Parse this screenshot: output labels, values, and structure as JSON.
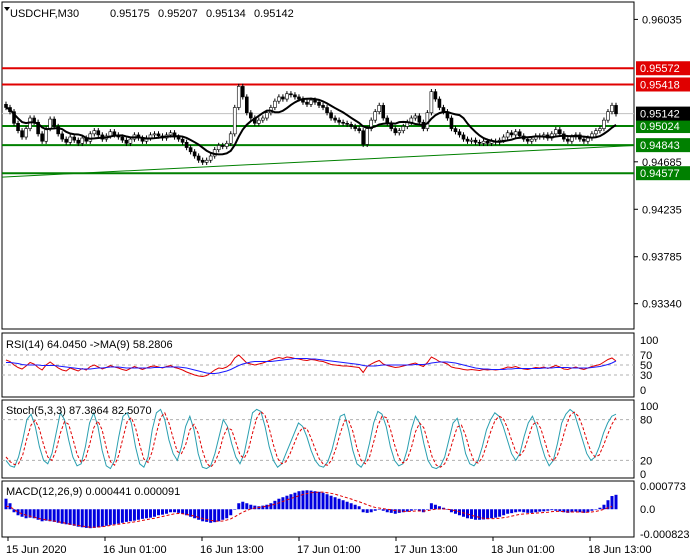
{
  "chart_data": [
    {
      "type": "candlestick",
      "title": "USDCHF,M30",
      "ohlc_header": [
        "0.95175",
        "0.95207",
        "0.95134",
        "0.95142"
      ],
      "ylim": [
        0.931,
        0.962
      ],
      "y_ticks": [
        "0.96035",
        "0.94685",
        "0.94235",
        "0.93785",
        "0.93340"
      ],
      "x_ticks": [
        "15 Jun 2020",
        "16 Jun 01:00",
        "16 Jun 13:00",
        "17 Jun 01:00",
        "17 Jun 13:00",
        "18 Jun 01:00",
        "18 Jun 13:00"
      ],
      "current_price": "0.95142",
      "levels": [
        {
          "label": "0.95572",
          "value": 0.95572,
          "color": "#e00000"
        },
        {
          "label": "0.95418",
          "value": 0.95418,
          "color": "#e00000"
        },
        {
          "label": "0.95024",
          "value": 0.95024,
          "color": "#008000"
        },
        {
          "label": "0.94843",
          "value": 0.94843,
          "color": "#008000"
        },
        {
          "label": "0.94577",
          "value": 0.94577,
          "color": "#008000"
        }
      ],
      "close": [
        0.952,
        0.9516,
        0.9505,
        0.9498,
        0.9492,
        0.95,
        0.951,
        0.9506,
        0.9495,
        0.9488,
        0.95,
        0.9509,
        0.9502,
        0.9495,
        0.949,
        0.9487,
        0.9492,
        0.9489,
        0.9486,
        0.9491,
        0.9488,
        0.9495,
        0.9498,
        0.9494,
        0.949,
        0.9493,
        0.9497,
        0.9494,
        0.9492,
        0.9489,
        0.9486,
        0.949,
        0.9494,
        0.9491,
        0.9488,
        0.9491,
        0.9494,
        0.9495,
        0.9493,
        0.9491,
        0.9494,
        0.9496,
        0.9492,
        0.949,
        0.9487,
        0.9482,
        0.9478,
        0.9474,
        0.947,
        0.9468,
        0.947,
        0.9474,
        0.948,
        0.9484,
        0.9483,
        0.9486,
        0.9495,
        0.952,
        0.954,
        0.953,
        0.9515,
        0.951,
        0.9505,
        0.9508,
        0.951,
        0.9515,
        0.952,
        0.9526,
        0.953,
        0.9528,
        0.9533,
        0.9532,
        0.953,
        0.9528,
        0.9525,
        0.9523,
        0.9527,
        0.9525,
        0.9522,
        0.952,
        0.9515,
        0.951,
        0.9508,
        0.9506,
        0.9505,
        0.9504,
        0.9502,
        0.95,
        0.9498,
        0.9485,
        0.95,
        0.9508,
        0.9516,
        0.9522,
        0.951,
        0.9505,
        0.95,
        0.9496,
        0.9498,
        0.9502,
        0.9506,
        0.951,
        0.9512,
        0.9506,
        0.95,
        0.9515,
        0.9535,
        0.9528,
        0.952,
        0.9516,
        0.951,
        0.95,
        0.9497,
        0.9494,
        0.949,
        0.9488,
        0.9489,
        0.9487,
        0.9486,
        0.9488,
        0.9486,
        0.9488,
        0.9487,
        0.9489,
        0.9492,
        0.9496,
        0.9494,
        0.9497,
        0.9493,
        0.949,
        0.9488,
        0.949,
        0.9493,
        0.9492,
        0.9494,
        0.9491,
        0.9495,
        0.9499,
        0.9495,
        0.949,
        0.9488,
        0.9492,
        0.9494,
        0.949,
        0.9488,
        0.9491,
        0.9495,
        0.9498,
        0.95,
        0.9508,
        0.9516,
        0.9522,
        0.9514
      ],
      "ma_note": "black moving average overlay",
      "trendline": {
        "from": 0.9454,
        "to": 0.9484,
        "color": "#008000"
      }
    },
    {
      "type": "line",
      "title": "RSI(14) 64.0450  ->MA(9) 58.2806",
      "ylim": [
        0,
        100
      ],
      "y_ticks": [
        "100",
        "70",
        "50",
        "30",
        "0"
      ],
      "values": [
        60,
        57,
        50,
        45,
        42,
        48,
        55,
        52,
        45,
        40,
        50,
        56,
        50,
        44,
        40,
        38,
        44,
        41,
        38,
        43,
        40,
        47,
        50,
        46,
        42,
        45,
        49,
        46,
        44,
        41,
        39,
        43,
        47,
        44,
        41,
        44,
        47,
        48,
        46,
        44,
        47,
        49,
        45,
        43,
        40,
        36,
        33,
        30,
        28,
        27,
        29,
        34,
        40,
        44,
        43,
        46,
        52,
        64,
        70,
        62,
        54,
        52,
        50,
        52,
        54,
        57,
        60,
        63,
        65,
        63,
        66,
        65,
        63,
        62,
        60,
        59,
        61,
        60,
        58,
        57,
        54,
        51,
        50,
        49,
        48,
        48,
        47,
        46,
        45,
        35,
        47,
        52,
        56,
        59,
        52,
        49,
        47,
        45,
        46,
        48,
        50,
        52,
        54,
        50,
        47,
        55,
        66,
        62,
        57,
        55,
        52,
        46,
        44,
        43,
        41,
        40,
        41,
        40,
        39,
        41,
        40,
        41,
        40,
        41,
        43,
        46,
        45,
        47,
        44,
        42,
        41,
        43,
        45,
        44,
        46,
        43,
        46,
        49,
        46,
        42,
        41,
        44,
        46,
        43,
        41,
        44,
        47,
        49,
        51,
        56,
        61,
        64,
        58
      ],
      "ma_values": [
        55,
        55,
        54,
        53,
        51,
        50,
        50,
        50,
        50,
        49,
        49,
        49,
        49,
        48,
        47,
        46,
        45,
        44,
        43,
        42,
        42,
        42,
        43,
        44,
        44,
        45,
        46,
        46,
        46,
        45,
        44,
        44,
        44,
        44,
        44,
        44,
        44,
        45,
        45,
        45,
        46,
        46,
        46,
        46,
        45,
        44,
        42,
        40,
        38,
        36,
        34,
        33,
        33,
        34,
        36,
        38,
        41,
        45,
        49,
        52,
        54,
        56,
        57,
        57,
        57,
        57,
        57,
        58,
        59,
        60,
        61,
        62,
        63,
        63,
        63,
        63,
        62,
        62,
        61,
        60,
        59,
        58,
        57,
        56,
        55,
        54,
        53,
        52,
        51,
        49,
        48,
        48,
        48,
        49,
        50,
        50,
        50,
        50,
        50,
        50,
        50,
        50,
        51,
        51,
        51,
        52,
        54,
        55,
        56,
        56,
        56,
        55,
        54,
        52,
        50,
        48,
        46,
        44,
        43,
        42,
        42,
        41,
        41,
        41,
        41,
        42,
        42,
        43,
        43,
        43,
        43,
        43,
        43,
        43,
        44,
        44,
        44,
        45,
        45,
        45,
        45,
        44,
        44,
        44,
        44,
        44,
        45,
        46,
        47,
        49,
        51,
        54,
        58
      ]
    },
    {
      "type": "line",
      "title": "Stoch(5,3,3) 87.3864 82.5070",
      "ylim": [
        0,
        100
      ],
      "y_ticks": [
        "100",
        "80",
        "20",
        "0"
      ],
      "series": [
        {
          "values": [
            20,
            12,
            10,
            25,
            50,
            80,
            88,
            70,
            40,
            20,
            15,
            30,
            60,
            90,
            80,
            50,
            25,
            12,
            15,
            40,
            75,
            90,
            70,
            35,
            12,
            8,
            20,
            55,
            85,
            90,
            75,
            40,
            15,
            10,
            25,
            65,
            90,
            95,
            80,
            50,
            30,
            20,
            40,
            70,
            85,
            65,
            30,
            10,
            8,
            12,
            30,
            55,
            80,
            70,
            45,
            25,
            15,
            30,
            60,
            90,
            95,
            92,
            70,
            40,
            20,
            10,
            15,
            30,
            45,
            60,
            75,
            70,
            55,
            35,
            20,
            12,
            10,
            18,
            35,
            60,
            85,
            88,
            65,
            35,
            15,
            10,
            20,
            45,
            75,
            92,
            88,
            70,
            40,
            20,
            12,
            15,
            35,
            65,
            85,
            75,
            45,
            20,
            10,
            8,
            12,
            25,
            50,
            75,
            82,
            60,
            30,
            15,
            12,
            20,
            40,
            65,
            80,
            90,
            85,
            70,
            50,
            30,
            20,
            30,
            55,
            75,
            85,
            70,
            45,
            25,
            12,
            20,
            45,
            75,
            88,
            95,
            90,
            70,
            50,
            30,
            20,
            25,
            40,
            60,
            75,
            85,
            88
          ]
        },
        {
          "values": [
            25,
            18,
            14,
            15,
            28,
            52,
            72,
            79,
            66,
            43,
            25,
            20,
            35,
            60,
            77,
            73,
            52,
            29,
            17,
            22,
            43,
            68,
            78,
            65,
            39,
            18,
            13,
            28,
            53,
            77,
            83,
            68,
            43,
            22,
            17,
            33,
            60,
            83,
            90,
            75,
            53,
            33,
            30,
            43,
            65,
            73,
            60,
            35,
            16,
            10,
            17,
            32,
            55,
            68,
            65,
            47,
            28,
            23,
            35,
            60,
            82,
            92,
            86,
            67,
            43,
            23,
            15,
            18,
            30,
            45,
            60,
            68,
            67,
            53,
            37,
            22,
            14,
            13,
            21,
            38,
            60,
            78,
            79,
            63,
            38,
            20,
            15,
            25,
            47,
            71,
            85,
            83,
            66,
            43,
            24,
            16,
            21,
            38,
            62,
            75,
            68,
            47,
            25,
            13,
            10,
            15,
            29,
            50,
            69,
            72,
            57,
            35,
            19,
            16,
            24,
            42,
            62,
            78,
            85,
            82,
            68,
            50,
            33,
            27,
            35,
            53,
            72,
            77,
            67,
            47,
            27,
            19,
            28,
            47,
            69,
            86,
            91,
            85,
            70,
            50,
            33,
            25,
            28,
            42,
            58,
            73,
            83
          ]
        }
      ]
    },
    {
      "type": "bar",
      "title": "MACD(12,26,9) 0.000441 0.000091",
      "y_ticks": [
        "0.000773",
        "0.0",
        "-0.000823"
      ],
      "ylim": [
        -0.000823,
        0.000773
      ],
      "values": [
        0.00035,
        0.0002,
        -0.0001,
        -0.0002,
        -0.00025,
        -0.0003,
        -0.00028,
        -0.0003,
        -0.00035,
        -0.0004,
        -0.00038,
        -0.0004,
        -0.00042,
        -0.00045,
        -0.00048,
        -0.0005,
        -0.00052,
        -0.00055,
        -0.00058,
        -0.0006,
        -0.00062,
        -0.00063,
        -0.00062,
        -0.0006,
        -0.00058,
        -0.00055,
        -0.00052,
        -0.0005,
        -0.00048,
        -0.00045,
        -0.00042,
        -0.0004,
        -0.00038,
        -0.00035,
        -0.00032,
        -0.0003,
        -0.00028,
        -0.00025,
        -0.0002,
        -0.00018,
        -0.00015,
        -0.0001,
        -0.0001,
        -0.00012,
        -0.00015,
        -0.0002,
        -0.00025,
        -0.0003,
        -0.00035,
        -0.0004,
        -0.00042,
        -0.00045,
        -0.00043,
        -0.0004,
        -0.00035,
        -0.0003,
        -0.0002,
        0.0,
        0.0002,
        0.00025,
        0.0002,
        0.00015,
        0.00012,
        0.0001,
        0.00012,
        0.00015,
        0.0002,
        0.00028,
        0.00035,
        0.0004,
        0.00045,
        0.0005,
        0.00055,
        0.0006,
        0.00062,
        0.00063,
        0.00062,
        0.0006,
        0.00058,
        0.00055,
        0.0005,
        0.00045,
        0.0004,
        0.00035,
        0.0003,
        0.00025,
        0.0002,
        0.00015,
        0.0001,
        -0.0001,
        -0.00012,
        -0.0001,
        -5e-05,
        0.0,
        -5e-05,
        -0.0001,
        -0.00012,
        -0.00015,
        -0.00012,
        -0.0001,
        -8e-05,
        -5e-05,
        0.0,
        -5e-05,
        -0.0001,
        0.0,
        0.0002,
        0.00015,
        0.0001,
        5e-05,
        0.0,
        -0.0001,
        -0.00015,
        -0.0002,
        -0.00025,
        -0.0003,
        -0.00032,
        -0.00035,
        -0.00035,
        -0.00034,
        -0.00033,
        -0.0003,
        -0.00028,
        -0.00025,
        -0.0002,
        -0.00015,
        -0.00013,
        -0.0001,
        -8e-05,
        -0.0001,
        -0.00012,
        -0.00012,
        -0.0001,
        -8e-05,
        -7e-05,
        -5e-05,
        -3e-05,
        -5e-05,
        -7e-05,
        -0.0001,
        -0.00012,
        -0.0001,
        -8e-05,
        -0.0001,
        -0.00012,
        -0.0001,
        -5e-05,
        0.0,
        5e-05,
        0.00015,
        0.0003,
        0.00044,
        0.00048
      ],
      "signal_values": [
        0.0001,
        8e-05,
        0.0,
        -0.0001,
        -0.00015,
        -0.0002,
        -0.00023,
        -0.00026,
        -0.0003,
        -0.00033,
        -0.00035,
        -0.00037,
        -0.00039,
        -0.00042,
        -0.00044,
        -0.00047,
        -0.0005,
        -0.00052,
        -0.00054,
        -0.00056,
        -0.00058,
        -0.0006,
        -0.0006,
        -0.00059,
        -0.00058,
        -0.00056,
        -0.00054,
        -0.00052,
        -0.0005,
        -0.00048,
        -0.00046,
        -0.00044,
        -0.00042,
        -0.0004,
        -0.00037,
        -0.00035,
        -0.00032,
        -0.0003,
        -0.00027,
        -0.00024,
        -0.00021,
        -0.00018,
        -0.00015,
        -0.00014,
        -0.00015,
        -0.00017,
        -0.0002,
        -0.00023,
        -0.00027,
        -0.00031,
        -0.00034,
        -0.00037,
        -0.00039,
        -0.0004,
        -0.00039,
        -0.00036,
        -0.00032,
        -0.00025,
        -0.00017,
        -0.0001,
        -4e-05,
        1e-05,
        4e-05,
        6e-05,
        8e-05,
        0.0001,
        0.00013,
        0.00017,
        0.00021,
        0.00026,
        0.00031,
        0.00036,
        0.0004,
        0.00045,
        0.00049,
        0.00052,
        0.00055,
        0.00056,
        0.00057,
        0.00057,
        0.00055,
        0.00053,
        0.0005,
        0.00046,
        0.00042,
        0.00038,
        0.00034,
        0.00029,
        0.00025,
        0.0002,
        0.00015,
        0.0001,
        6e-05,
        4e-05,
        2e-05,
        0.0,
        -2e-05,
        -4e-05,
        -6e-05,
        -7e-05,
        -7e-05,
        -7e-05,
        -6e-05,
        -6e-05,
        -6e-05,
        -5e-05,
        -2e-05,
        0.0,
        1e-05,
        1e-05,
        0.0,
        -2e-05,
        -5e-05,
        -8e-05,
        -0.00012,
        -0.00016,
        -0.0002,
        -0.00024,
        -0.00027,
        -0.0003,
        -0.00031,
        -0.00031,
        -0.00031,
        -0.0003,
        -0.00028,
        -0.00026,
        -0.00023,
        -0.0002,
        -0.00017,
        -0.00016,
        -0.00015,
        -0.00014,
        -0.00013,
        -0.00012,
        -0.00011,
        -0.0001,
        -8e-05,
        -7e-05,
        -7e-05,
        -8e-05,
        -9e-05,
        -9e-05,
        -9e-05,
        -9e-05,
        -0.0001,
        -0.0001,
        -9e-05,
        -7e-05,
        -4e-05,
        0.0,
        5e-05,
        9e-05
      ]
    }
  ]
}
